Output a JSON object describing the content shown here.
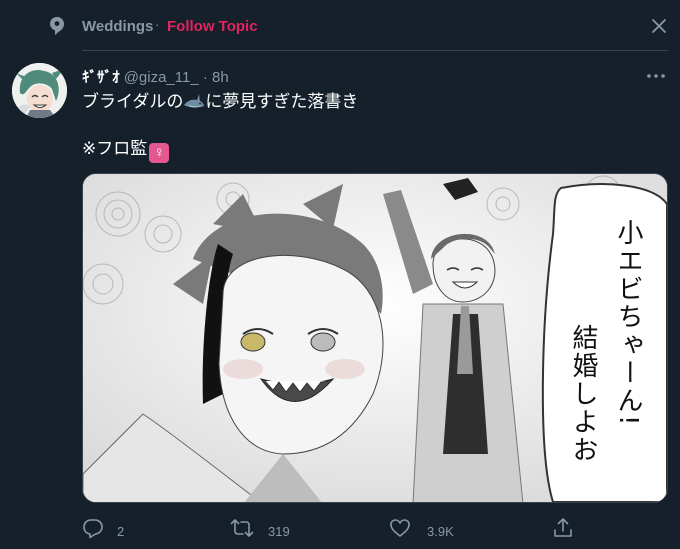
{
  "topic": {
    "name": "Weddings",
    "separator": "·",
    "follow_label": "Follow Topic"
  },
  "tweet": {
    "display_name": "ｷﾞｻﾞｵ",
    "handle": "@giza_11_",
    "separator": "·",
    "time": "8h",
    "text_before": "ブライダルの",
    "text_after": "に夢見すぎた落書き",
    "line2": "※フロ監",
    "venus_emoji": "♀",
    "speech_bubble": [
      "小エビちゃーん!",
      "結婚しよお"
    ]
  },
  "actions": {
    "reply_count": "2",
    "retweet_count": "319",
    "like_count": "3.9K"
  },
  "icons": {
    "topic": "topic-pin-icon",
    "close": "close-icon",
    "more": "more-icon",
    "reply": "reply-icon",
    "retweet": "retweet-icon",
    "like": "heart-icon",
    "share": "share-icon",
    "shark_emoji": "shark-emoji-icon"
  },
  "colors": {
    "background": "#15202b",
    "follow_topic": "#e0245e",
    "muted": "#8899a6",
    "divider": "#38444d"
  }
}
